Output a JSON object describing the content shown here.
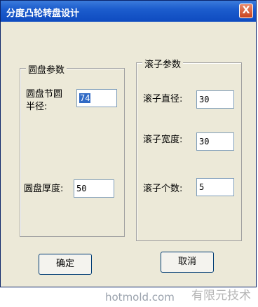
{
  "window": {
    "title": "分度凸轮转盘设计",
    "close_glyph": "X"
  },
  "disc_group": {
    "legend": "圆盘参数",
    "pitch_label_line1": "圆盘节圆",
    "pitch_label_line2": "半径:",
    "pitch_value": "74",
    "thickness_label": "圆盘厚度:",
    "thickness_value": "50"
  },
  "roller_group": {
    "legend": "滚子参数",
    "diameter_label": "滚子直径:",
    "diameter_value": "30",
    "width_label": "滚子宽度:",
    "width_value": "30",
    "count_label": "滚子个数:",
    "count_value": "5"
  },
  "buttons": {
    "ok": "确定",
    "cancel": "取消"
  },
  "watermark": {
    "site": "hotmold.com",
    "brand": "有限元技术"
  }
}
